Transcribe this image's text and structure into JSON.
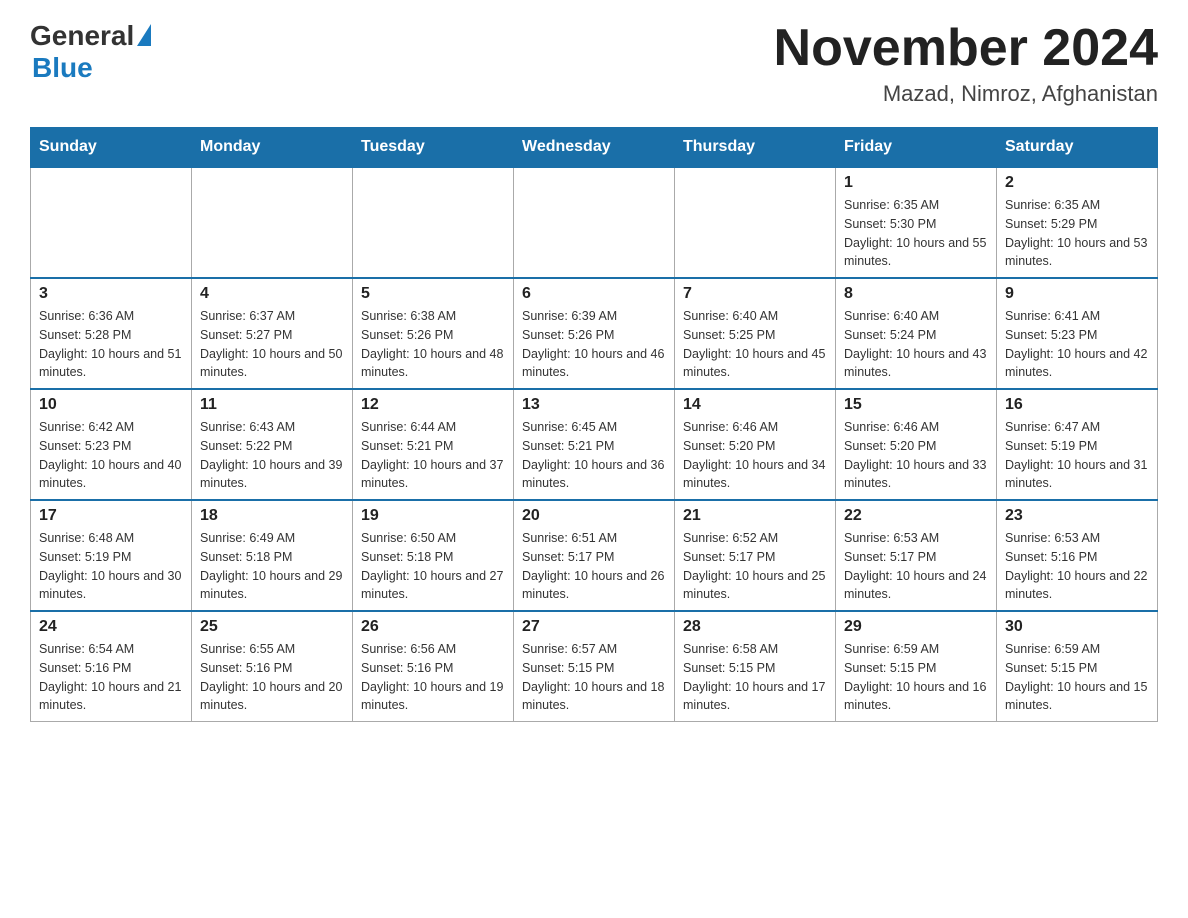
{
  "header": {
    "logo_general": "General",
    "logo_blue": "Blue",
    "month_title": "November 2024",
    "location": "Mazad, Nimroz, Afghanistan"
  },
  "weekdays": [
    "Sunday",
    "Monday",
    "Tuesday",
    "Wednesday",
    "Thursday",
    "Friday",
    "Saturday"
  ],
  "weeks": [
    [
      {
        "day": "",
        "info": ""
      },
      {
        "day": "",
        "info": ""
      },
      {
        "day": "",
        "info": ""
      },
      {
        "day": "",
        "info": ""
      },
      {
        "day": "",
        "info": ""
      },
      {
        "day": "1",
        "info": "Sunrise: 6:35 AM\nSunset: 5:30 PM\nDaylight: 10 hours and 55 minutes."
      },
      {
        "day": "2",
        "info": "Sunrise: 6:35 AM\nSunset: 5:29 PM\nDaylight: 10 hours and 53 minutes."
      }
    ],
    [
      {
        "day": "3",
        "info": "Sunrise: 6:36 AM\nSunset: 5:28 PM\nDaylight: 10 hours and 51 minutes."
      },
      {
        "day": "4",
        "info": "Sunrise: 6:37 AM\nSunset: 5:27 PM\nDaylight: 10 hours and 50 minutes."
      },
      {
        "day": "5",
        "info": "Sunrise: 6:38 AM\nSunset: 5:26 PM\nDaylight: 10 hours and 48 minutes."
      },
      {
        "day": "6",
        "info": "Sunrise: 6:39 AM\nSunset: 5:26 PM\nDaylight: 10 hours and 46 minutes."
      },
      {
        "day": "7",
        "info": "Sunrise: 6:40 AM\nSunset: 5:25 PM\nDaylight: 10 hours and 45 minutes."
      },
      {
        "day": "8",
        "info": "Sunrise: 6:40 AM\nSunset: 5:24 PM\nDaylight: 10 hours and 43 minutes."
      },
      {
        "day": "9",
        "info": "Sunrise: 6:41 AM\nSunset: 5:23 PM\nDaylight: 10 hours and 42 minutes."
      }
    ],
    [
      {
        "day": "10",
        "info": "Sunrise: 6:42 AM\nSunset: 5:23 PM\nDaylight: 10 hours and 40 minutes."
      },
      {
        "day": "11",
        "info": "Sunrise: 6:43 AM\nSunset: 5:22 PM\nDaylight: 10 hours and 39 minutes."
      },
      {
        "day": "12",
        "info": "Sunrise: 6:44 AM\nSunset: 5:21 PM\nDaylight: 10 hours and 37 minutes."
      },
      {
        "day": "13",
        "info": "Sunrise: 6:45 AM\nSunset: 5:21 PM\nDaylight: 10 hours and 36 minutes."
      },
      {
        "day": "14",
        "info": "Sunrise: 6:46 AM\nSunset: 5:20 PM\nDaylight: 10 hours and 34 minutes."
      },
      {
        "day": "15",
        "info": "Sunrise: 6:46 AM\nSunset: 5:20 PM\nDaylight: 10 hours and 33 minutes."
      },
      {
        "day": "16",
        "info": "Sunrise: 6:47 AM\nSunset: 5:19 PM\nDaylight: 10 hours and 31 minutes."
      }
    ],
    [
      {
        "day": "17",
        "info": "Sunrise: 6:48 AM\nSunset: 5:19 PM\nDaylight: 10 hours and 30 minutes."
      },
      {
        "day": "18",
        "info": "Sunrise: 6:49 AM\nSunset: 5:18 PM\nDaylight: 10 hours and 29 minutes."
      },
      {
        "day": "19",
        "info": "Sunrise: 6:50 AM\nSunset: 5:18 PM\nDaylight: 10 hours and 27 minutes."
      },
      {
        "day": "20",
        "info": "Sunrise: 6:51 AM\nSunset: 5:17 PM\nDaylight: 10 hours and 26 minutes."
      },
      {
        "day": "21",
        "info": "Sunrise: 6:52 AM\nSunset: 5:17 PM\nDaylight: 10 hours and 25 minutes."
      },
      {
        "day": "22",
        "info": "Sunrise: 6:53 AM\nSunset: 5:17 PM\nDaylight: 10 hours and 24 minutes."
      },
      {
        "day": "23",
        "info": "Sunrise: 6:53 AM\nSunset: 5:16 PM\nDaylight: 10 hours and 22 minutes."
      }
    ],
    [
      {
        "day": "24",
        "info": "Sunrise: 6:54 AM\nSunset: 5:16 PM\nDaylight: 10 hours and 21 minutes."
      },
      {
        "day": "25",
        "info": "Sunrise: 6:55 AM\nSunset: 5:16 PM\nDaylight: 10 hours and 20 minutes."
      },
      {
        "day": "26",
        "info": "Sunrise: 6:56 AM\nSunset: 5:16 PM\nDaylight: 10 hours and 19 minutes."
      },
      {
        "day": "27",
        "info": "Sunrise: 6:57 AM\nSunset: 5:15 PM\nDaylight: 10 hours and 18 minutes."
      },
      {
        "day": "28",
        "info": "Sunrise: 6:58 AM\nSunset: 5:15 PM\nDaylight: 10 hours and 17 minutes."
      },
      {
        "day": "29",
        "info": "Sunrise: 6:59 AM\nSunset: 5:15 PM\nDaylight: 10 hours and 16 minutes."
      },
      {
        "day": "30",
        "info": "Sunrise: 6:59 AM\nSunset: 5:15 PM\nDaylight: 10 hours and 15 minutes."
      }
    ]
  ]
}
